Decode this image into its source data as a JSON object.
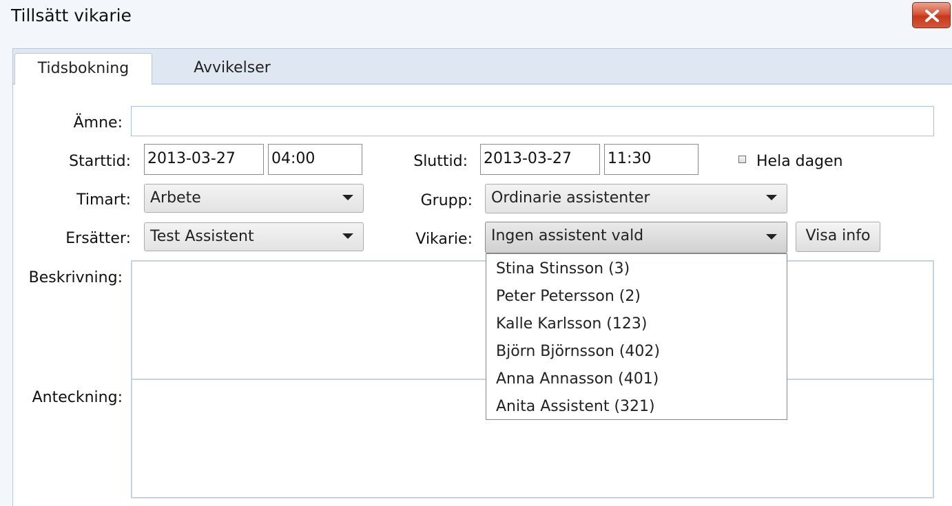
{
  "window": {
    "title": "Tillsätt vikarie"
  },
  "tabs": [
    {
      "label": "Tidsbokning",
      "active": true
    },
    {
      "label": "Avvikelser",
      "active": false
    }
  ],
  "form": {
    "subject_label": "Ämne:",
    "subject_value": "",
    "start_label": "Starttid:",
    "start_date": "2013-03-27",
    "start_time": "04:00",
    "end_label": "Sluttid:",
    "end_date": "2013-03-27",
    "end_time": "11:30",
    "allday_label": "Hela dagen",
    "allday_checked": false,
    "timart_label": "Timart:",
    "timart_value": "Arbete",
    "group_label": "Grupp:",
    "group_value": "Ordinarie assistenter",
    "replaces_label": "Ersätter:",
    "replaces_value": "Test Assistent",
    "substitute_label": "Vikarie:",
    "substitute_value": "Ingen assistent vald",
    "info_button": "Visa info",
    "description_label": "Beskrivning:",
    "note_label": "Anteckning:"
  },
  "substitute_options": [
    "Stina Stinsson (3)",
    "Peter Petersson (2)",
    "Kalle Karlsson (123)",
    "Björn Björnsson (402)",
    "Anna Annasson (401)",
    "Anita Assistent (321)"
  ],
  "colors": {
    "close_button": "#d7553a",
    "tab_strip": "#dfe8f2"
  }
}
